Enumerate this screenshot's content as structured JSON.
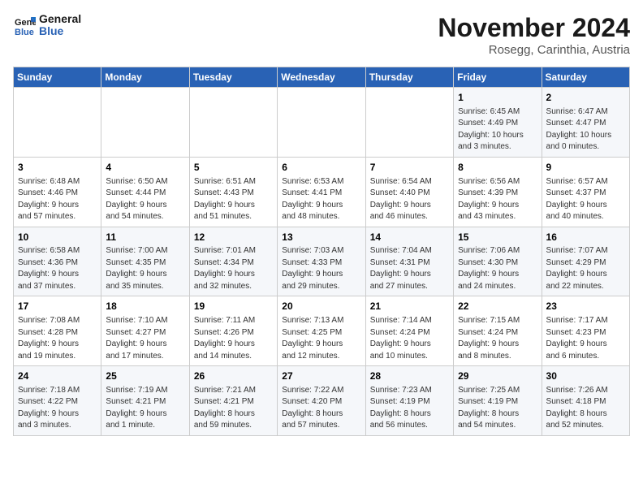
{
  "logo": {
    "line1": "General",
    "line2": "Blue"
  },
  "title": "November 2024",
  "location": "Rosegg, Carinthia, Austria",
  "days_header": [
    "Sunday",
    "Monday",
    "Tuesday",
    "Wednesday",
    "Thursday",
    "Friday",
    "Saturday"
  ],
  "weeks": [
    [
      {
        "day": "",
        "info": ""
      },
      {
        "day": "",
        "info": ""
      },
      {
        "day": "",
        "info": ""
      },
      {
        "day": "",
        "info": ""
      },
      {
        "day": "",
        "info": ""
      },
      {
        "day": "1",
        "info": "Sunrise: 6:45 AM\nSunset: 4:49 PM\nDaylight: 10 hours\nand 3 minutes."
      },
      {
        "day": "2",
        "info": "Sunrise: 6:47 AM\nSunset: 4:47 PM\nDaylight: 10 hours\nand 0 minutes."
      }
    ],
    [
      {
        "day": "3",
        "info": "Sunrise: 6:48 AM\nSunset: 4:46 PM\nDaylight: 9 hours\nand 57 minutes."
      },
      {
        "day": "4",
        "info": "Sunrise: 6:50 AM\nSunset: 4:44 PM\nDaylight: 9 hours\nand 54 minutes."
      },
      {
        "day": "5",
        "info": "Sunrise: 6:51 AM\nSunset: 4:43 PM\nDaylight: 9 hours\nand 51 minutes."
      },
      {
        "day": "6",
        "info": "Sunrise: 6:53 AM\nSunset: 4:41 PM\nDaylight: 9 hours\nand 48 minutes."
      },
      {
        "day": "7",
        "info": "Sunrise: 6:54 AM\nSunset: 4:40 PM\nDaylight: 9 hours\nand 46 minutes."
      },
      {
        "day": "8",
        "info": "Sunrise: 6:56 AM\nSunset: 4:39 PM\nDaylight: 9 hours\nand 43 minutes."
      },
      {
        "day": "9",
        "info": "Sunrise: 6:57 AM\nSunset: 4:37 PM\nDaylight: 9 hours\nand 40 minutes."
      }
    ],
    [
      {
        "day": "10",
        "info": "Sunrise: 6:58 AM\nSunset: 4:36 PM\nDaylight: 9 hours\nand 37 minutes."
      },
      {
        "day": "11",
        "info": "Sunrise: 7:00 AM\nSunset: 4:35 PM\nDaylight: 9 hours\nand 35 minutes."
      },
      {
        "day": "12",
        "info": "Sunrise: 7:01 AM\nSunset: 4:34 PM\nDaylight: 9 hours\nand 32 minutes."
      },
      {
        "day": "13",
        "info": "Sunrise: 7:03 AM\nSunset: 4:33 PM\nDaylight: 9 hours\nand 29 minutes."
      },
      {
        "day": "14",
        "info": "Sunrise: 7:04 AM\nSunset: 4:31 PM\nDaylight: 9 hours\nand 27 minutes."
      },
      {
        "day": "15",
        "info": "Sunrise: 7:06 AM\nSunset: 4:30 PM\nDaylight: 9 hours\nand 24 minutes."
      },
      {
        "day": "16",
        "info": "Sunrise: 7:07 AM\nSunset: 4:29 PM\nDaylight: 9 hours\nand 22 minutes."
      }
    ],
    [
      {
        "day": "17",
        "info": "Sunrise: 7:08 AM\nSunset: 4:28 PM\nDaylight: 9 hours\nand 19 minutes."
      },
      {
        "day": "18",
        "info": "Sunrise: 7:10 AM\nSunset: 4:27 PM\nDaylight: 9 hours\nand 17 minutes."
      },
      {
        "day": "19",
        "info": "Sunrise: 7:11 AM\nSunset: 4:26 PM\nDaylight: 9 hours\nand 14 minutes."
      },
      {
        "day": "20",
        "info": "Sunrise: 7:13 AM\nSunset: 4:25 PM\nDaylight: 9 hours\nand 12 minutes."
      },
      {
        "day": "21",
        "info": "Sunrise: 7:14 AM\nSunset: 4:24 PM\nDaylight: 9 hours\nand 10 minutes."
      },
      {
        "day": "22",
        "info": "Sunrise: 7:15 AM\nSunset: 4:24 PM\nDaylight: 9 hours\nand 8 minutes."
      },
      {
        "day": "23",
        "info": "Sunrise: 7:17 AM\nSunset: 4:23 PM\nDaylight: 9 hours\nand 6 minutes."
      }
    ],
    [
      {
        "day": "24",
        "info": "Sunrise: 7:18 AM\nSunset: 4:22 PM\nDaylight: 9 hours\nand 3 minutes."
      },
      {
        "day": "25",
        "info": "Sunrise: 7:19 AM\nSunset: 4:21 PM\nDaylight: 9 hours\nand 1 minute."
      },
      {
        "day": "26",
        "info": "Sunrise: 7:21 AM\nSunset: 4:21 PM\nDaylight: 8 hours\nand 59 minutes."
      },
      {
        "day": "27",
        "info": "Sunrise: 7:22 AM\nSunset: 4:20 PM\nDaylight: 8 hours\nand 57 minutes."
      },
      {
        "day": "28",
        "info": "Sunrise: 7:23 AM\nSunset: 4:19 PM\nDaylight: 8 hours\nand 56 minutes."
      },
      {
        "day": "29",
        "info": "Sunrise: 7:25 AM\nSunset: 4:19 PM\nDaylight: 8 hours\nand 54 minutes."
      },
      {
        "day": "30",
        "info": "Sunrise: 7:26 AM\nSunset: 4:18 PM\nDaylight: 8 hours\nand 52 minutes."
      }
    ]
  ]
}
